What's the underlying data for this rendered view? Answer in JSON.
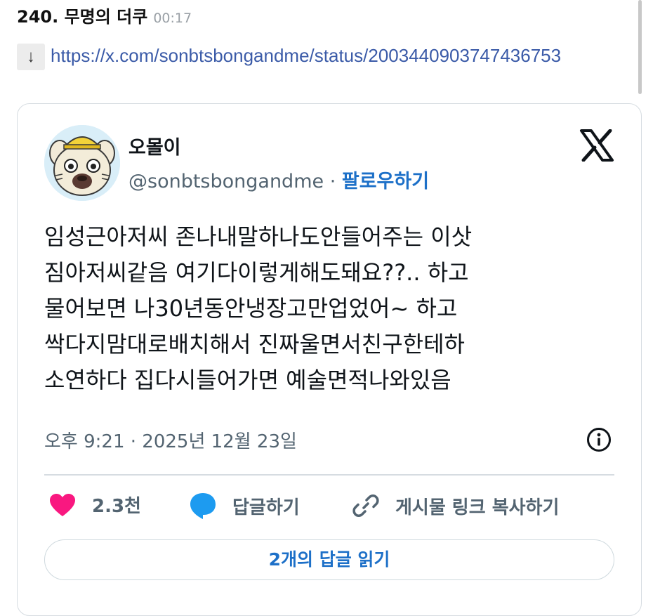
{
  "post": {
    "number": "240. 무명의 더쿠",
    "time": "00:17"
  },
  "link": {
    "icon": "download-arrow-icon",
    "arrow": "↓",
    "url": "https://x.com/sonbtsbongandme/status/2003440903747436753"
  },
  "tweet": {
    "display_name": "오몰이",
    "handle": "@sonbtsbongandme",
    "separator": " · ",
    "follow_label": "팔로우하기",
    "text": "임성근아저씨 존나내말하나도안들어주는 이삿\n짐아저씨같음 여기다이렇게해도돼요??.. 하고\n물어보면 나30년동안냉장고만업었어~ 하고\n싹다지맘대로배치해서 진짜울면서친구한테하\n소연하다 집다시들어가면 예술면적나와있음",
    "timestamp": "오후 9:21 · 2025년 12월 23일",
    "likes": "2.3천",
    "reply_label": "답글하기",
    "copy_link_label": "게시물 링크 복사하기",
    "read_replies_label": "2개의 답글 읽기"
  },
  "colors": {
    "link_blue": "#3b5ba8",
    "follow_blue": "#1d70c8",
    "like_pink": "#f91880",
    "reply_blue": "#1d9bf0",
    "secondary_text": "#536471"
  }
}
